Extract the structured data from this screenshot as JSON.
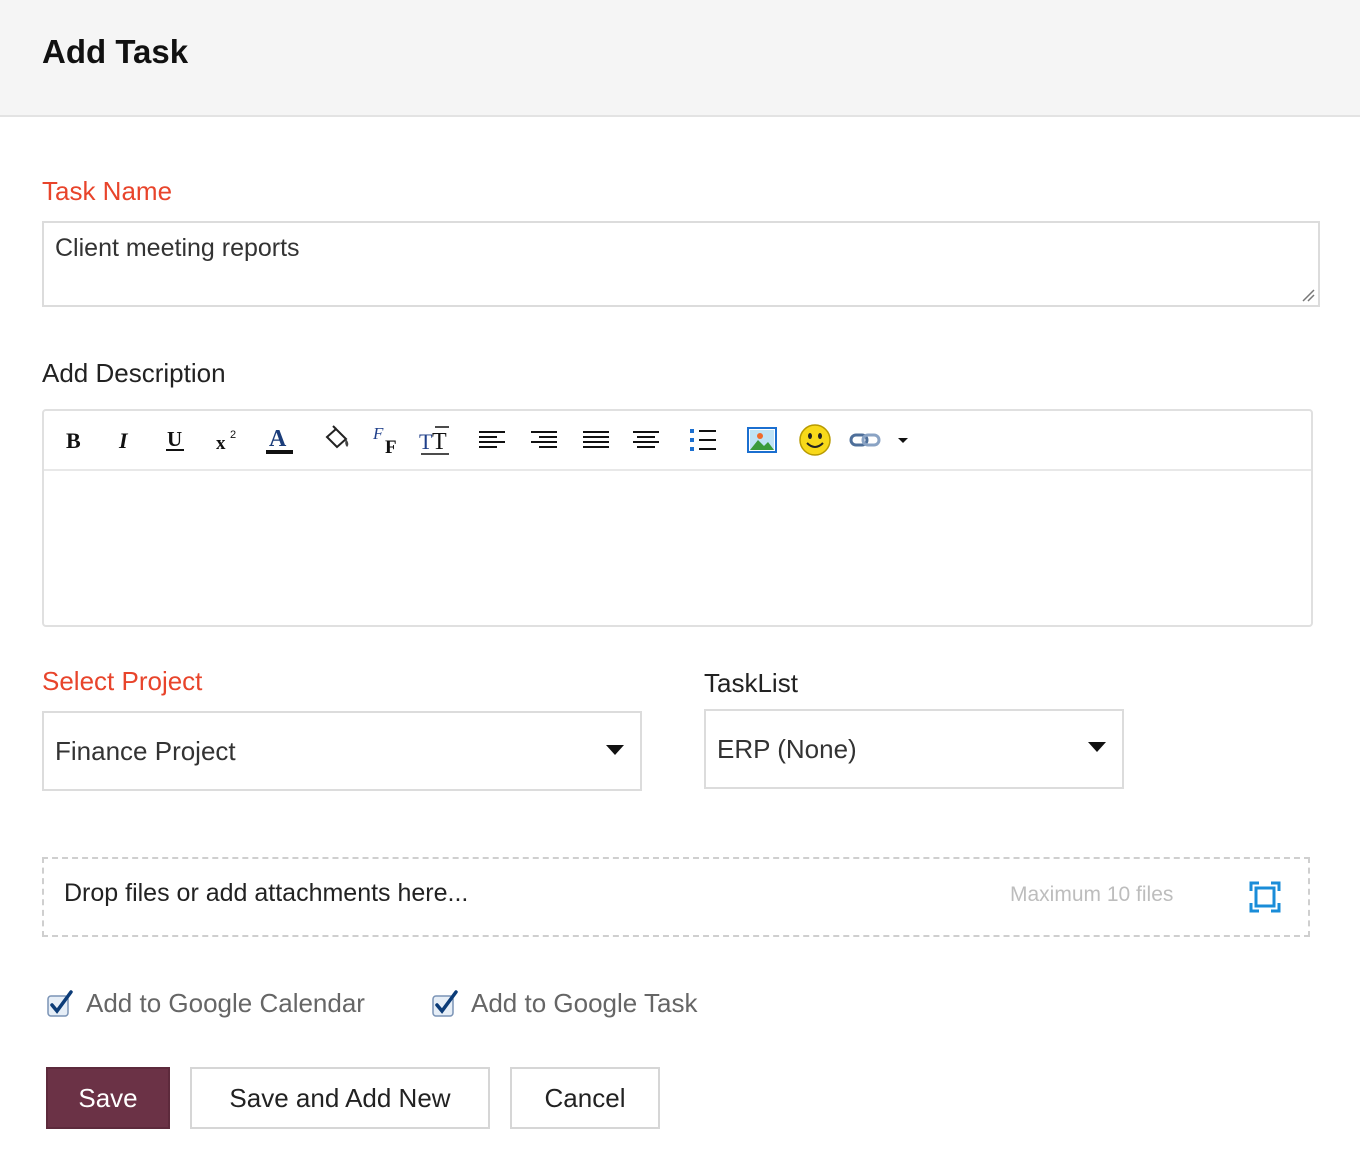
{
  "header": {
    "title": "Add Task"
  },
  "task_name": {
    "label": "Task Name",
    "value": "Client meeting reports"
  },
  "description": {
    "label": "Add Description",
    "toolbar": [
      {
        "name": "bold-icon",
        "glyph": "B"
      },
      {
        "name": "italic-icon",
        "glyph": "I"
      },
      {
        "name": "underline-icon",
        "glyph": "U"
      },
      {
        "name": "superscript-icon"
      },
      {
        "name": "font-color-icon"
      },
      {
        "name": "background-color-icon"
      },
      {
        "name": "font-family-icon"
      },
      {
        "name": "font-size-icon"
      },
      {
        "name": "align-left-icon"
      },
      {
        "name": "align-right-icon"
      },
      {
        "name": "justify-icon"
      },
      {
        "name": "align-center-icon"
      },
      {
        "name": "bullet-list-icon"
      },
      {
        "name": "insert-image-icon"
      },
      {
        "name": "emoji-icon"
      },
      {
        "name": "insert-link-icon"
      },
      {
        "name": "more-dropdown-icon"
      }
    ],
    "value": ""
  },
  "project": {
    "label": "Select Project",
    "selected": "Finance Project"
  },
  "tasklist": {
    "label": "TaskList",
    "selected": "ERP (None)"
  },
  "attachments": {
    "prompt": "Drop files or add attachments here...",
    "limit": "Maximum 10 files"
  },
  "options": {
    "google_calendar": {
      "label": "Add to Google Calendar",
      "checked": true
    },
    "google_task": {
      "label": "Add to Google Task",
      "checked": true
    }
  },
  "actions": {
    "save": "Save",
    "save_and_new": "Save and Add New",
    "cancel": "Cancel"
  },
  "colors": {
    "required_label": "#e8442b",
    "primary_button": "#6b3246",
    "checkbox_tick": "#0c5aa8",
    "expand_icon": "#1a8cd8"
  }
}
